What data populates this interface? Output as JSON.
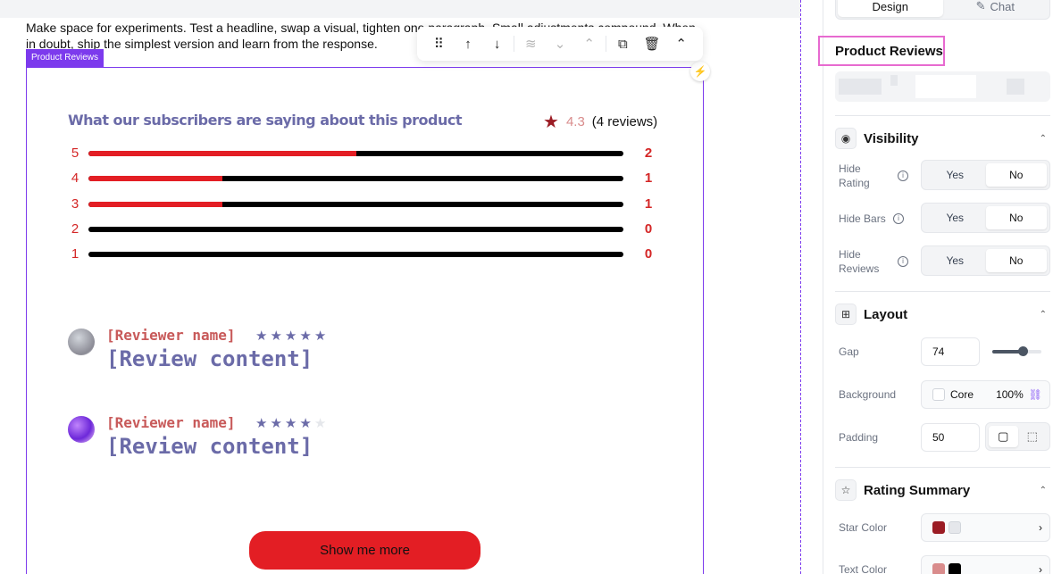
{
  "canvas": {
    "intro_text": "Make space for experiments. Test a headline, swap a visual, tighten one paragraph. Small adjustments compound. When in doubt, ship the simplest version and learn from the response.",
    "widget_tag": "Product Reviews"
  },
  "toolbar": {
    "items": [
      "drag-handle-icon",
      "move-up-icon",
      "move-down-icon",
      "layers-icon",
      "move-to-bottom-icon",
      "move-to-top-icon",
      "duplicate-icon",
      "delete-icon",
      "collapse-icon"
    ]
  },
  "reviews": {
    "title": "What our subscribers are saying about this product",
    "average": "4.3",
    "count_text": "(4 reviews)",
    "bars": [
      {
        "stars": "5",
        "count": "2",
        "fraction": 0.5
      },
      {
        "stars": "4",
        "count": "1",
        "fraction": 0.25
      },
      {
        "stars": "3",
        "count": "1",
        "fraction": 0.25
      },
      {
        "stars": "2",
        "count": "0",
        "fraction": 0
      },
      {
        "stars": "1",
        "count": "0",
        "fraction": 0
      }
    ],
    "items": [
      {
        "name": "[Reviewer name]",
        "content": "[Review content]",
        "rating": 5
      },
      {
        "name": "[Reviewer name]",
        "content": "[Review content]",
        "rating": 4
      }
    ],
    "more_button": "Show me more"
  },
  "panel": {
    "tabs": {
      "design": "Design",
      "chat": "Chat"
    },
    "selected_title": "Product Reviews",
    "visibility": {
      "label": "Visibility",
      "hide_rating": "Hide Rating",
      "hide_bars": "Hide Bars",
      "hide_reviews": "Hide Reviews",
      "yes": "Yes",
      "no": "No",
      "selected": "No"
    },
    "layout": {
      "label": "Layout",
      "gap_label": "Gap",
      "gap_value": "74",
      "gap_slider_fraction": 0.62,
      "background_label": "Background",
      "background_name": "Core",
      "background_opacity": "100%",
      "padding_label": "Padding",
      "padding_value": "50"
    },
    "rating_summary": {
      "label": "Rating Summary",
      "star_color_label": "Star Color",
      "text_color_label": "Text Color"
    }
  },
  "colors": {
    "accent": "#7c3aed",
    "highlight": "#e76ad0",
    "star": "#9b1c24",
    "bar_fill": "#e31e24",
    "title": "#6b6ba8",
    "reviewer": "#c85a5a"
  }
}
